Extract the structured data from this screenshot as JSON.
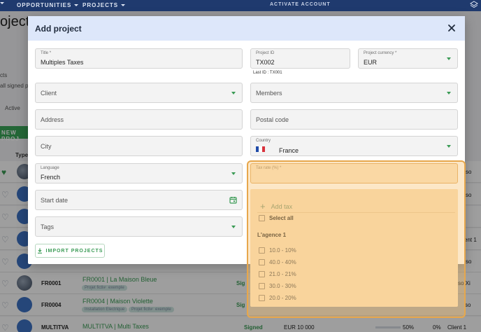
{
  "nav": {
    "opportunities": "OPPORTUNITIES",
    "projects": "PROJECTS",
    "activate": "ACTIVATE ACCOUNT"
  },
  "background": {
    "title": "ojects",
    "text1": "cts",
    "text2": "all signed p",
    "status": "Active",
    "new_button": "NEW PROJ",
    "type_header": "Type",
    "rows": [
      {
        "code": "FR0001",
        "name": "FR0001 | La Maison Bleue",
        "tags": [
          "Projet fictive",
          "exemple"
        ],
        "right": "so Xi",
        "signed": "Sig"
      },
      {
        "code": "FR0004",
        "name": "FR0004 | Maison Violette",
        "tags": [
          "Installation Electrique",
          "Projet fictive",
          "exemple"
        ],
        "right": "so",
        "signed": "Sig"
      },
      {
        "code": "MULTITVA",
        "name": "MULTITVA | Multi Taxes",
        "signed": "Signed",
        "amount": "EUR 10 000",
        "progress_text": "50%",
        "progress": 0.5,
        "pct2": "0%",
        "client": "Client 1"
      }
    ],
    "side_labels": [
      "so",
      "so",
      "ent 1",
      "so"
    ]
  },
  "modal": {
    "title": "Add project",
    "title_field": {
      "label": "Title *",
      "value": "Multiples Taxes"
    },
    "project_id": {
      "label": "Project ID",
      "value": "TX002",
      "hint": "Last ID : TX001"
    },
    "currency": {
      "label": "Project currency *",
      "value": "EUR"
    },
    "client": {
      "placeholder": "Client"
    },
    "members": {
      "placeholder": "Members"
    },
    "address": {
      "placeholder": "Address"
    },
    "postal_code": {
      "placeholder": "Postal code"
    },
    "city": {
      "placeholder": "City"
    },
    "country": {
      "label": "Country",
      "value": "France"
    },
    "language": {
      "label": "Language",
      "value": "French"
    },
    "tax_rate": {
      "label": "Tax rate (%) *"
    },
    "start_date": {
      "placeholder": "Start date"
    },
    "tags": {
      "placeholder": "Tags"
    },
    "import_button": "IMPORT PROJECTS"
  },
  "tax_menu": {
    "add_tax": "Add tax",
    "select_all": "Select all",
    "group": "L'agence 1",
    "options": [
      "10.0 - 10%",
      "40.0 - 40%",
      "21.0 - 21%",
      "30.0 - 30%",
      "20.0 - 20%"
    ]
  },
  "colors": {
    "nav_bg": "#1f3a6e",
    "accent_green": "#3a9b55",
    "modal_header": "#dde7fa",
    "highlight": "#e7a74c"
  }
}
